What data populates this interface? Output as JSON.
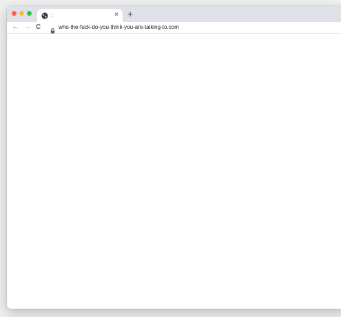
{
  "window": {
    "traffic_lights": {
      "close_color": "#fe5f57",
      "minimize_color": "#febc2e",
      "zoom_color": "#28c840"
    }
  },
  "tab": {
    "favicon": "globe-icon",
    "title": ":",
    "close_label": "×"
  },
  "new_tab": {
    "label": "+"
  },
  "toolbar": {
    "back_label": "←",
    "forward_label": "→",
    "reload_label": "C",
    "url": "who-the-fuck-do-you-think-you-are-talking-to.com"
  },
  "colors": {
    "titlebar_bg": "#dee1e6",
    "page_bg": "#ffffff"
  }
}
